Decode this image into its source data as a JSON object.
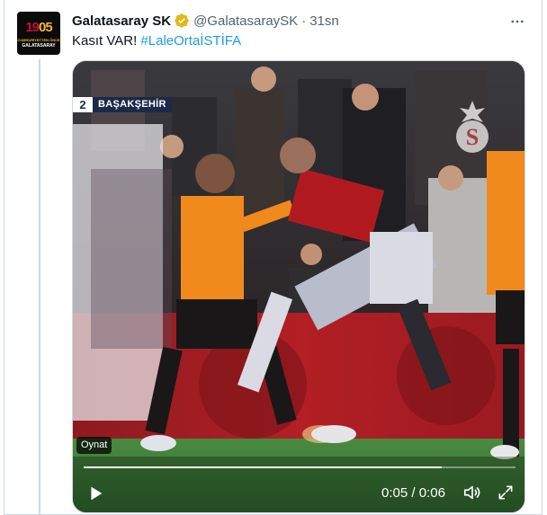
{
  "author": {
    "display_name": "Galatasaray SK",
    "handle": "@GalatasaraySK",
    "separator": "·",
    "time": "31sn",
    "avatar": {
      "logo_year_a": "19",
      "logo_year_b": "05",
      "logo_line1": "CUMHURİYETTEN ÖNCE",
      "logo_line2": "GALATASARAY"
    },
    "verified_icon": "verified-badge-icon"
  },
  "more_icon": "more-horizontal-icon",
  "tweet": {
    "text_prefix": "Kasıt VAR! ",
    "hashtag": "#LaleOrtaİSTİFA"
  },
  "media": {
    "scoreboard": {
      "score": "2",
      "team": "BAŞAKŞEHİR"
    },
    "badge_label": "Oynat",
    "player": {
      "progress": 0.83,
      "current_time": "0:05",
      "time_separator": " / ",
      "duration": "0:06",
      "play_icon": "play-icon",
      "volume_icon": "volume-icon",
      "fullscreen_icon": "fullscreen-icon"
    },
    "watermark_icon": "galatasaray-logo-icon"
  },
  "colors": {
    "hashtag": "#1d9bf0",
    "secondary_text": "#536471",
    "verified_gold": "#e2b719",
    "border": "#cfd9de",
    "kit_orange": "#f08a1c",
    "kit_red": "#b01a1f",
    "pitch_green": "#3f7a3a"
  }
}
